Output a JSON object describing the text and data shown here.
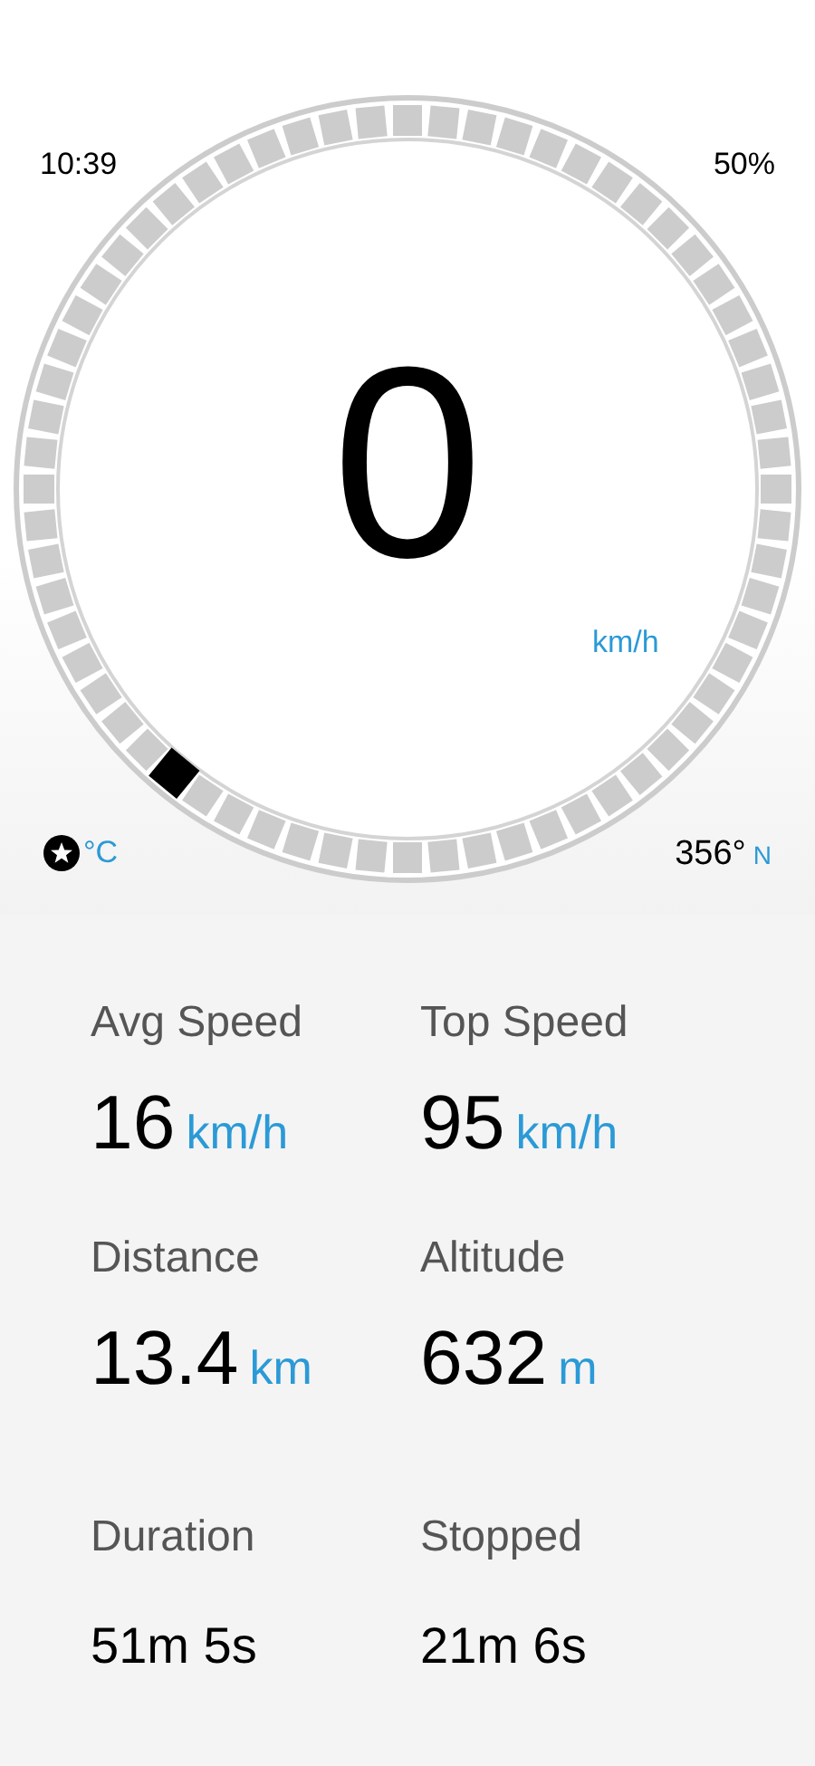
{
  "status": {
    "time": "10:39",
    "battery": "50%"
  },
  "speedometer": {
    "speed": "0",
    "unit": "km/h"
  },
  "temperature": {
    "unit": "°C"
  },
  "heading": {
    "degrees": "356°",
    "direction": "N"
  },
  "stats": [
    {
      "kind": "large",
      "label": "Avg Speed",
      "value": "16",
      "unit": "km/h"
    },
    {
      "kind": "large",
      "label": "Top Speed",
      "value": "95",
      "unit": "km/h"
    },
    {
      "kind": "large",
      "label": "Distance",
      "value": "13.4",
      "unit": "km"
    },
    {
      "kind": "large",
      "label": "Altitude",
      "value": "632",
      "unit": "m"
    },
    {
      "kind": "small",
      "label": "Duration",
      "value": "51m 5s"
    },
    {
      "kind": "small",
      "label": "Stopped",
      "value": "21m 6s"
    }
  ]
}
